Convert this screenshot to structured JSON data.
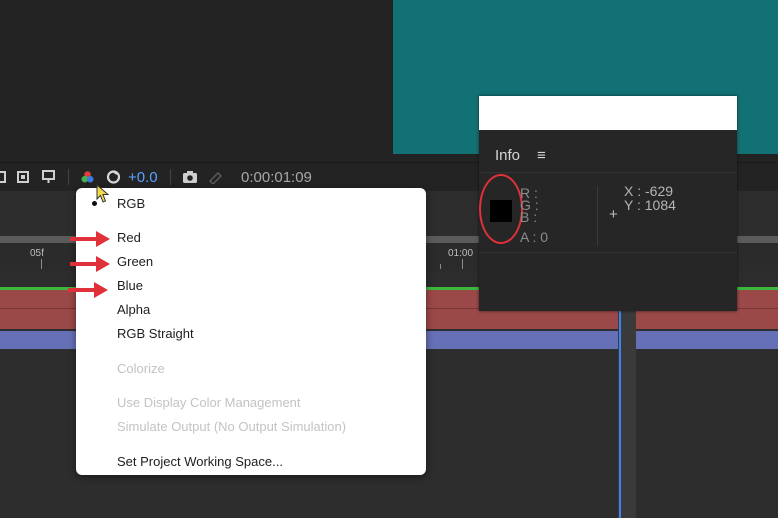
{
  "toolbar": {
    "exposure_value": "+0.0",
    "timecode": "0:00:01:09"
  },
  "timeline": {
    "ruler_labels": [
      "05f",
      "01:00"
    ]
  },
  "channel_menu": {
    "items": [
      {
        "label": "RGB",
        "selected": true,
        "enabled": true
      },
      {
        "label": "Red",
        "enabled": true
      },
      {
        "label": "Green",
        "enabled": true
      },
      {
        "label": "Blue",
        "enabled": true
      },
      {
        "label": "Alpha",
        "enabled": true
      },
      {
        "label": "RGB Straight",
        "enabled": true
      },
      {
        "label": "Colorize",
        "enabled": false
      },
      {
        "label": "Use Display Color Management",
        "enabled": false
      },
      {
        "label": "Simulate Output (No Output Simulation)",
        "enabled": false
      },
      {
        "label": "Set Project Working Space...",
        "enabled": true
      }
    ]
  },
  "info_panel": {
    "title": "Info",
    "menu_icon": "hamburger-icon",
    "channels": {
      "r": "R :",
      "g": "G :",
      "b": "B :",
      "a": "A : 0"
    },
    "coordinates": {
      "x": "X : -629",
      "y": "Y : 1084"
    },
    "swatch_color": "#000000"
  },
  "colors": {
    "comp_canvas": "#127175",
    "annotation_red": "#e0303a",
    "exposure_blue": "#5aa1ff",
    "playhead_blue": "#3f82f3"
  }
}
